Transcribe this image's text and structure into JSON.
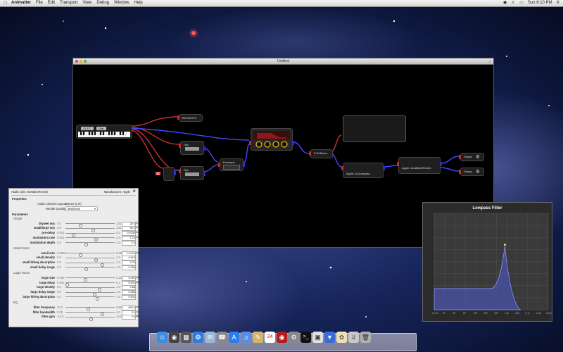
{
  "menubar": {
    "app_name": "Animatter",
    "menus": [
      "File",
      "Edit",
      "Transport",
      "View",
      "Debug",
      "Window",
      "Help"
    ],
    "clock": "Sun 6:10 PM",
    "icons": [
      "apple-icon",
      "wifi-icon",
      "volume-icon",
      "battery-icon",
      "spotlight-icon"
    ]
  },
  "main_window": {
    "title": "Untitled",
    "nodes": {
      "keyboard_a": "CCCC",
      "keyboard_b": "Gbb",
      "top_label": "BH:HHH75",
      "osc1": "Osc",
      "osc2": "Osc",
      "envelope": "Envelope",
      "mini_port": "A",
      "fx_out": "FxToMono",
      "lowpass": "Apple: AULowpass",
      "reverb": "Apple: AUMatrixReverb",
      "out1": "Output",
      "out2": "Output",
      "out1_port": "1",
      "out2_port": "2"
    }
  },
  "inspector": {
    "title": "Audio Unit: AUMatrixReverb",
    "manufacturer": "Manufacturer: Apple",
    "properties_label": "Properties",
    "channel_layout_label": "Audio Channel Layout:",
    "channel_layout_value": "Stereo (L R)",
    "render_quality_label": "Render Quality:",
    "render_quality_value": "Maximum",
    "parameters_label": "Parameters",
    "groups": [
      {
        "name": "Global",
        "params": [
          {
            "name": "dry/wet mix",
            "min": "0.0",
            "max": "100.0",
            "value": "28.0",
            "unit": "%",
            "pos": 0.28
          },
          {
            "name": "small/large mix",
            "min": "0.0",
            "max": "100.0",
            "value": "55.0",
            "unit": "%",
            "pos": 0.55
          },
          {
            "name": "pre-delay",
            "min": "0.001",
            "max": "0.1",
            "value": "0.0149",
            "unit": "Secs",
            "pos": 0.14
          },
          {
            "name": "modulation rate",
            "min": "0.001",
            "max": "2.0",
            "value": "1.22",
            "unit": "Hz",
            "pos": 0.61
          },
          {
            "name": "modulation depth",
            "min": "0.0",
            "max": "1.0",
            "value": "0.4",
            "unit": "",
            "pos": 0.4
          }
        ]
      },
      {
        "name": "Small Room",
        "params": [
          {
            "name": "small size",
            "min": "0.0001",
            "max": "0.05",
            "value": "0.0147",
            "unit": "Secs",
            "pos": 0.29
          },
          {
            "name": "small density",
            "min": "0.0",
            "max": "1.0",
            "value": "0.615",
            "unit": "",
            "pos": 0.615
          },
          {
            "name": "small hifreq absorption",
            "min": "0.0",
            "max": "1.0",
            "value": "0.75",
            "unit": "",
            "pos": 0.75
          },
          {
            "name": "small delay range",
            "min": "0.0",
            "max": "1.0",
            "value": "0.396",
            "unit": "",
            "pos": 0.396
          }
        ]
      },
      {
        "name": "Large Room",
        "params": [
          {
            "name": "large size",
            "min": "0.005",
            "max": "0.15",
            "value": "0.061",
            "unit": "Secs",
            "pos": 0.39
          },
          {
            "name": "large delay",
            "min": "0.001",
            "max": "0.1",
            "value": "0.001",
            "unit": "Secs",
            "pos": 0.0
          },
          {
            "name": "large density",
            "min": "0.0",
            "max": "1.0",
            "value": "0.68",
            "unit": "",
            "pos": 0.68
          },
          {
            "name": "large delay range",
            "min": "0.0",
            "max": "1.0",
            "value": "0.580",
            "unit": "",
            "pos": 0.58
          },
          {
            "name": "large hifreq absorption",
            "min": "0.0",
            "max": "1.0",
            "value": "0.641",
            "unit": "",
            "pos": 0.641
          }
        ]
      },
      {
        "name": "EQ",
        "params": [
          {
            "name": "filter frequency",
            "min": "10.0",
            "max": "20000",
            "value": "800.0",
            "unit": "Hz",
            "pos": 0.45
          },
          {
            "name": "filter bandwidth",
            "min": "0.05",
            "max": "4.0",
            "value": "3.0",
            "unit": "Oct",
            "pos": 0.75
          },
          {
            "name": "filter gain",
            "min": "-18.0",
            "max": "18.0",
            "value": "0.0",
            "unit": "dB",
            "pos": 0.5
          }
        ]
      }
    ]
  },
  "lowpass_window": {
    "title": "Lowpass Filter",
    "x_ticks": [
      "10 Hz",
      "20",
      "40",
      "80",
      "160",
      "320",
      "640",
      "1.3k",
      "2.6k",
      "5.1k",
      "10.2k",
      "20.5k"
    ],
    "cutoff_fraction": 0.62
  },
  "dock": {
    "icons": [
      "finder-icon",
      "dashboard-icon",
      "mission-control-icon",
      "safari-icon",
      "mail-icon",
      "facetime-icon",
      "app-store-icon",
      "itunes-icon",
      "notes-icon",
      "calendar-icon",
      "photo-booth-icon",
      "system-preferences-icon",
      "terminal-icon",
      "preview-icon",
      "animatter-icon",
      "plugin-icon",
      "downloads-icon",
      "trash-icon"
    ],
    "calendar_day": "24"
  }
}
